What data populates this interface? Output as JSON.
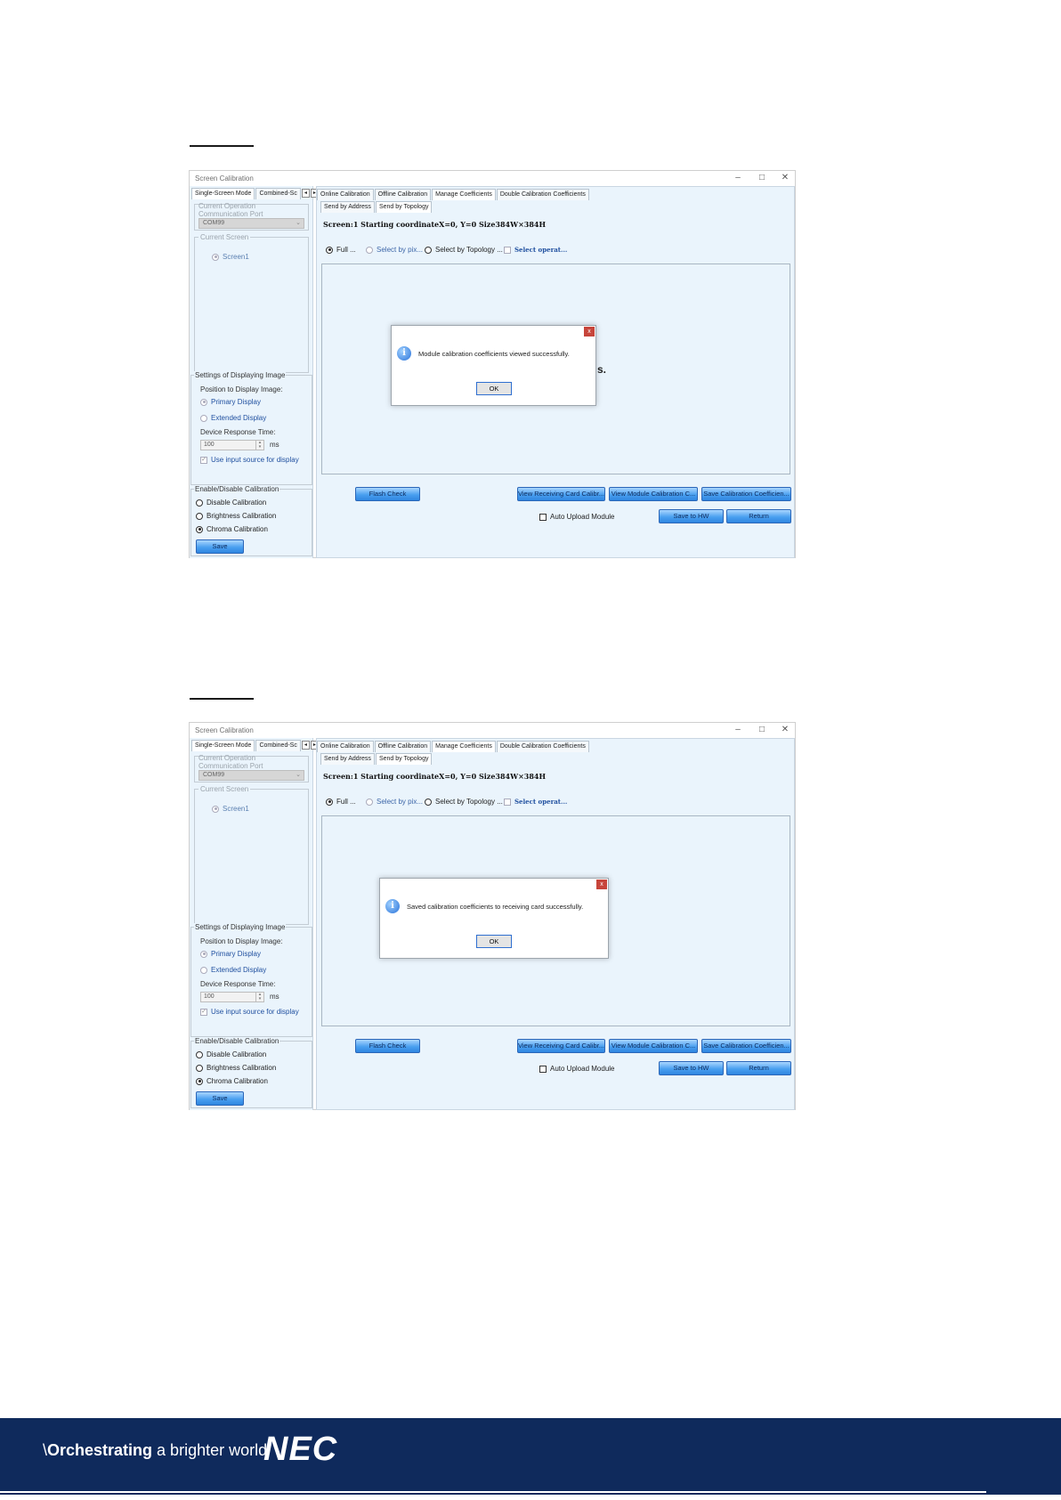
{
  "window": {
    "title": "Screen Calibration",
    "controls": [
      "–",
      "□",
      "✕"
    ],
    "left_tabs": [
      "Single-Screen Mode",
      "Combined-Sc"
    ],
    "tab_arrows": [
      "◂",
      "▸"
    ],
    "top_tabs": [
      "Online Calibration",
      "Offline Calibration",
      "Manage Coefficients",
      "Double Calibration Coefficients"
    ],
    "sub_tabs": [
      "Send by Address",
      "Send by Topology"
    ],
    "current_operation": "Current Operation",
    "comm_port_label": "Communication Port",
    "comm_port_value": "COM99",
    "current_screen": "Current Screen",
    "screen_item": "Screen1",
    "display_settings": "Settings of Displaying Image",
    "position_label": "Position to Display Image:",
    "primary_display": "Primary Display",
    "extended_display": "Extended Display",
    "response_time_label": "Device Response Time:",
    "response_time_value": "100",
    "ms": "ms",
    "use_input_source": "Use input source for display",
    "enable_group": "Enable/Disable Calibration",
    "disable_calibration": "Disable Calibration",
    "brightness_calibration": "Brightness Calibration",
    "chroma_calibration": "Chroma Calibration",
    "save": "Save",
    "screen_info": "Screen:1  Starting coordinateX=0, Y=0   Size384W×384H",
    "radio_full": "Full ...",
    "radio_pixel": "Select by pix...",
    "radio_topology": "Select by Topology ...",
    "select_operat": "Select operat...",
    "flash_check": "Flash Check",
    "view_receiving": "View Receiving Card Calibr...",
    "view_module": "View Module Calibration C...",
    "save_coefficients": "Save Calibration Coefficien...",
    "auto_upload": "Auto Upload Module",
    "save_to_hw": "Save to HW",
    "return": "Return",
    "ok": "OK"
  },
  "screenshots": [
    {
      "dialog_message": "Module calibration coefficients viewed successfully.",
      "behind_fragment": "s."
    },
    {
      "dialog_message": "Saved calibration coefficients to receiving card successfully."
    }
  ],
  "footer": {
    "slogan_bold": "Orchestrating",
    "slogan_rest": " a brighter world",
    "slogan_prefix": "\\",
    "logo": "NEC"
  },
  "colors": {
    "footer_bg": "#0f2a5c",
    "panel_bg": "#eaf4fc",
    "button_blue": "#4aa0f0",
    "close_red": "#c7453b"
  }
}
